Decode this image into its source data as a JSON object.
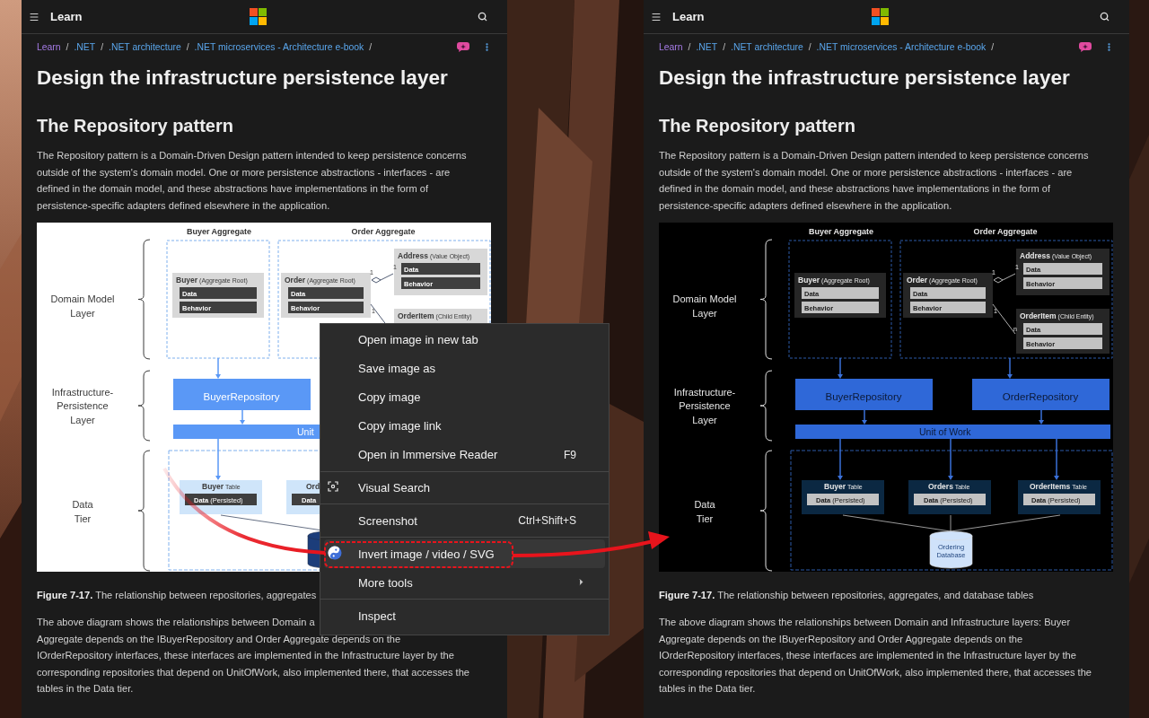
{
  "panes": [
    {
      "header": {
        "title": "Learn"
      },
      "breadcrumb": {
        "separator": "/",
        "items": [
          {
            "label": "Learn",
            "visited": true
          },
          {
            "label": ".NET",
            "visited": false
          },
          {
            "label": ".NET architecture",
            "visited": false
          },
          {
            "label": ".NET microservices - Architecture e-book",
            "visited": false
          }
        ]
      },
      "title": "Design the infrastructure persistence layer",
      "heading": "The Repository pattern",
      "intro": [
        "The Repository pattern is a Domain-Driven Design pattern intended to keep persistence concerns",
        "outside of the system's domain model. One or more persistence abstractions - interfaces - are",
        "defined in the domain model, and these abstractions have implementations in the form of",
        "persistence-specific adapters defined elsewhere in the application."
      ],
      "diagram": {
        "inverted": false,
        "layer_labels": [
          {
            "lines": [
              "Domain Model",
              "Layer"
            ]
          },
          {
            "lines": [
              "Infrastructure-",
              "Persistence",
              "Layer"
            ]
          },
          {
            "lines": [
              "Data",
              "Tier"
            ]
          }
        ],
        "aggregates": [
          "Buyer Aggregate",
          "Order Aggregate"
        ],
        "entities": [
          {
            "name": "Buyer",
            "role": "(Aggregate Root)",
            "rows": [
              "Data",
              "Behavior"
            ]
          },
          {
            "name": "Order",
            "role": "(Aggregate Root)",
            "rows": [
              "Data",
              "Behavior"
            ]
          },
          {
            "name": "Address",
            "role": "(Value Object)",
            "rows": [
              "Data",
              "Behavior"
            ]
          },
          {
            "name": "OrderItem",
            "role": "(Child Entity)"
          }
        ],
        "multiplicities": [
          "1",
          "1",
          "1"
        ],
        "repositories": [
          "BuyerRepository"
        ],
        "unit_of_work": "Unit",
        "tables": [
          {
            "name": "Buyer",
            "suffix": "Table",
            "data": "Data",
            "note": "(Persisted)"
          },
          {
            "name": "Ord",
            "data": "Data"
          }
        ]
      },
      "caption": "**Figure 7-17.** The relationship between repositories, aggregates",
      "body": [
        "The above diagram shows the relationships between Domain a",
        "Aggregate depends on the IBuyerRepository and Order Aggregate depends on the",
        "IOrderRepository interfaces, these interfaces are implemented in the Infrastructure layer by the",
        "corresponding repositories that depend on UnitOfWork, also implemented there, that accesses the",
        "tables in the Data tier."
      ]
    },
    {
      "header": {
        "title": "Learn"
      },
      "breadcrumb": {
        "separator": "/",
        "items": [
          {
            "label": "Learn",
            "visited": true
          },
          {
            "label": ".NET",
            "visited": false
          },
          {
            "label": ".NET architecture",
            "visited": false
          },
          {
            "label": ".NET microservices - Architecture e-book",
            "visited": false
          }
        ]
      },
      "title": "Design the infrastructure persistence layer",
      "heading": "The Repository pattern",
      "intro": [
        "The Repository pattern is a Domain-Driven Design pattern intended to keep persistence concerns",
        "outside of the system's domain model. One or more persistence abstractions - interfaces - are",
        "defined in the domain model, and these abstractions have implementations in the form of",
        "persistence-specific adapters defined elsewhere in the application."
      ],
      "diagram": {
        "inverted": true,
        "layer_labels": [
          {
            "lines": [
              "Domain Model",
              "Layer"
            ]
          },
          {
            "lines": [
              "Infrastructure-",
              "Persistence",
              "Layer"
            ]
          },
          {
            "lines": [
              "Data",
              "Tier"
            ]
          }
        ],
        "aggregates": [
          "Buyer Aggregate",
          "Order Aggregate"
        ],
        "entities": [
          {
            "name": "Buyer",
            "role": "(Aggregate Root)",
            "rows": [
              "Data",
              "Behavior"
            ]
          },
          {
            "name": "Order",
            "role": "(Aggregate Root)",
            "rows": [
              "Data",
              "Behavior"
            ]
          },
          {
            "name": "Address",
            "role": "(Value Object)",
            "rows": [
              "Data",
              "Behavior"
            ]
          },
          {
            "name": "OrderItem",
            "role": "(Child Entity)",
            "rows": [
              "Data",
              "Behavior"
            ]
          }
        ],
        "multiplicities": [
          "1",
          "1",
          "1",
          "n"
        ],
        "repositories": [
          "BuyerRepository",
          "OrderRepository"
        ],
        "unit_of_work": "Unit of Work",
        "tables": [
          {
            "name": "Buyer",
            "suffix": "Table",
            "data": "Data",
            "note": "(Persisted)"
          },
          {
            "name": "Orders",
            "suffix": "Table",
            "data": "Data",
            "note": "(Persisted)"
          },
          {
            "name": "OrderItems",
            "suffix": "Table",
            "data": "Data",
            "note": "(Persisted)"
          }
        ],
        "database": [
          "Ordering",
          "Database"
        ]
      },
      "caption": "**Figure 7-17.** The relationship between repositories, aggregates, and database tables",
      "body": [
        "The above diagram shows the relationships between Domain and Infrastructure layers: Buyer",
        "Aggregate depends on the IBuyerRepository and Order Aggregate depends on the",
        "IOrderRepository interfaces, these interfaces are implemented in the Infrastructure layer by the",
        "corresponding repositories that depend on UnitOfWork, also implemented there, that accesses the",
        "tables in the Data tier."
      ]
    }
  ],
  "context_menu": {
    "items": [
      {
        "kind": "item",
        "label": "Open image in new tab",
        "highlighted": false
      },
      {
        "kind": "item",
        "label": "Save image as",
        "highlighted": false
      },
      {
        "kind": "item",
        "label": "Copy image",
        "highlighted": false
      },
      {
        "kind": "item",
        "label": "Copy image link",
        "highlighted": false
      },
      {
        "kind": "item",
        "label": "Open in Immersive Reader",
        "shortcut": "F9",
        "highlighted": false
      },
      {
        "kind": "separator"
      },
      {
        "kind": "item",
        "label": "Visual Search",
        "highlighted": false
      },
      {
        "kind": "separator"
      },
      {
        "kind": "item",
        "label": "Screenshot",
        "shortcut": "Ctrl+Shift+S",
        "highlighted": false
      },
      {
        "kind": "separator"
      },
      {
        "kind": "item",
        "label": "Invert image / video / SVG",
        "highlighted": true
      },
      {
        "kind": "item",
        "label": "More tools",
        "submenu": true,
        "highlighted": false
      },
      {
        "kind": "separator"
      },
      {
        "kind": "item",
        "label": "Inspect",
        "highlighted": false
      }
    ]
  }
}
